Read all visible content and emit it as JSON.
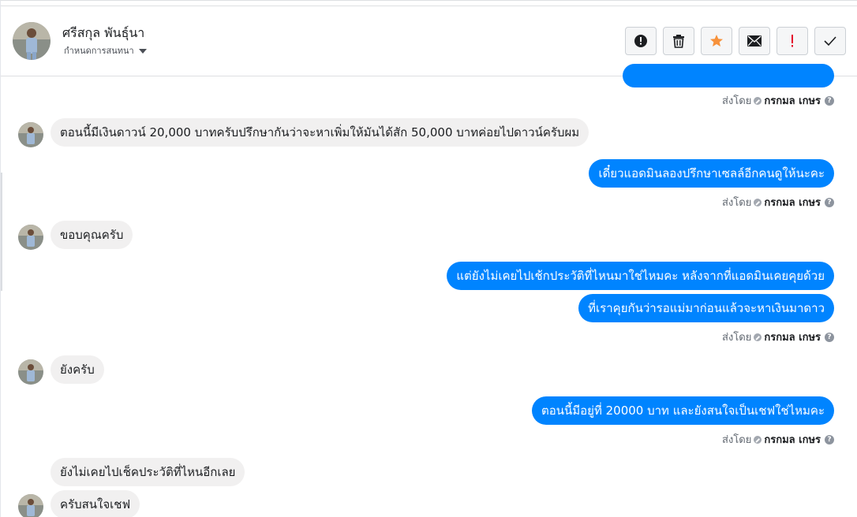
{
  "header": {
    "contact_name": "ศรีสกุล พันธุ์นา",
    "assign_label": "กำหนดการสนทนา",
    "actions": [
      {
        "icon": "alert-circle-icon",
        "name": "mark-spam-button"
      },
      {
        "icon": "trash-icon",
        "name": "delete-button"
      },
      {
        "icon": "star-icon",
        "name": "star-button"
      },
      {
        "icon": "envelope-icon",
        "name": "mark-unread-button"
      },
      {
        "icon": "exclamation-icon",
        "name": "follow-up-button"
      },
      {
        "icon": "check-icon",
        "name": "mark-done-button"
      }
    ],
    "star_color": "#f7923b",
    "red_color": "#e4002b"
  },
  "sent_by": {
    "prefix": "ส่งโดย",
    "name": "กรกมล เกษร",
    "help": "?"
  },
  "messages": {
    "m1": "ตอนนี้มีเงินดาวน์ 20,000 บาทครับปรึกษากันว่าจะหาเพิ่มให้มันได้สัก 50,000 บาทค่อยไปดาวน์ครับผม",
    "m2": "เดี๋ยวแอดมินลองปรึกษาเซลล์อีกคนดูให้นะคะ",
    "m3": "ขอบคุณครับ",
    "m4": "แต่ยังไม่เคยไปเช้กประวัติที่ไหนมาใช่ไหมคะ หลังจากที่แอดมินเคยคุยด้วย",
    "m5": "ที่เราคุยกันว่ารอแม่มาก่อนแล้วจะหาเงินมาดาว",
    "m6": "ยังครับ",
    "m7": "ตอนนี้มีอยู่ที่ 20000 บาท และยังสนใจเป็นเชฟใช่ไหมคะ",
    "m8": "ยังไม่เคยไปเช็คประวัติที่ไหนอีกเลย",
    "m9": "ครับสนใจเชฟ"
  },
  "colors": {
    "outgoing_bubble": "#0084ff",
    "incoming_bubble": "#f1f0f0"
  }
}
